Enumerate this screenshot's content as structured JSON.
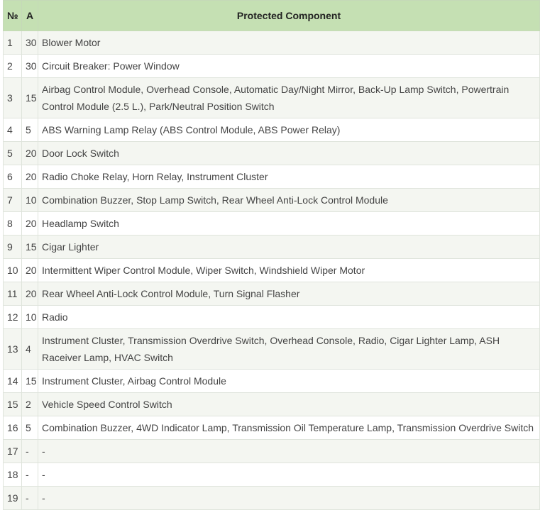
{
  "table": {
    "headers": [
      "№",
      "A",
      "Protected Component"
    ],
    "rows": [
      {
        "no": "1",
        "amps": "30",
        "component": "Blower Motor"
      },
      {
        "no": "2",
        "amps": "30",
        "component": "Circuit Breaker: Power Window"
      },
      {
        "no": "3",
        "amps": "15",
        "component": "Airbag Control Module, Overhead Console, Automatic Day/Night Mirror, Back-Up Lamp Switch, Powertrain Control Module (2.5 L.), Park/Neutral Position Switch"
      },
      {
        "no": "4",
        "amps": "5",
        "component": "ABS Warning Lamp Relay (ABS Control Module, ABS Power Relay)"
      },
      {
        "no": "5",
        "amps": "20",
        "component": "Door Lock Switch"
      },
      {
        "no": "6",
        "amps": "20",
        "component": "Radio Choke Relay, Horn Relay, Instrument Cluster"
      },
      {
        "no": "7",
        "amps": "10",
        "component": "Combination Buzzer, Stop Lamp Switch, Rear Wheel Anti-Lock Control Module"
      },
      {
        "no": "8",
        "amps": "20",
        "component": "Headlamp Switch"
      },
      {
        "no": "9",
        "amps": "15",
        "component": "Cigar Lighter"
      },
      {
        "no": "10",
        "amps": "20",
        "component": "Intermittent Wiper Control Module, Wiper Switch, Windshield Wiper Motor"
      },
      {
        "no": "11",
        "amps": "20",
        "component": "Rear Wheel Anti-Lock Control Module, Turn Signal Flasher"
      },
      {
        "no": "12",
        "amps": "10",
        "component": "Radio"
      },
      {
        "no": "13",
        "amps": "4",
        "component": "Instrument Cluster, Transmission Overdrive Switch, Overhead Console, Radio, Cigar Lighter Lamp, ASH Raceiver Lamp, HVAC Switch"
      },
      {
        "no": "14",
        "amps": "15",
        "component": "Instrument Cluster, Airbag Control Module"
      },
      {
        "no": "15",
        "amps": "2",
        "component": "Vehicle Speed Control Switch"
      },
      {
        "no": "16",
        "amps": "5",
        "component": "Combination Buzzer, 4WD Indicator Lamp, Transmission Oil Temperature Lamp, Transmission Overdrive Switch"
      },
      {
        "no": "17",
        "amps": "-",
        "component": "-"
      },
      {
        "no": "18",
        "amps": "-",
        "component": "-"
      },
      {
        "no": "19",
        "amps": "-",
        "component": "-"
      }
    ]
  }
}
